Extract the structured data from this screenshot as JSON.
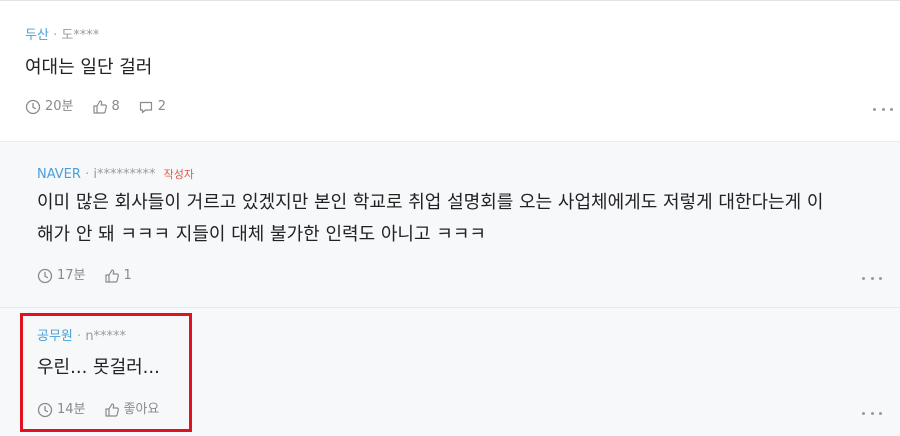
{
  "comments": [
    {
      "company": "두산",
      "separator": "·",
      "user": "도****",
      "author_tag": "",
      "text": "여대는 일단 걸러",
      "time": "20분",
      "likes": "8",
      "replies": "2"
    },
    {
      "company": "NAVER",
      "separator": "·",
      "user": "i*********",
      "author_tag": "작성자",
      "text_line1": "이미 많은 회사들이 거르고 있겠지만 본인 학교로 취업 설명회를 오는 사업체에게도 저렇게 대한다는게 이",
      "text_line2": "해가 안 돼 ㅋㅋㅋ 지들이 대체 불가한 인력도 아니고 ㅋㅋㅋ",
      "time": "17분",
      "likes": "1"
    },
    {
      "company": "공무원",
      "separator": "·",
      "user": "n*****",
      "author_tag": "",
      "text": "우린... 못걸러...",
      "time": "14분",
      "likes": "좋아요"
    }
  ],
  "icons": {
    "time": "clock-icon",
    "like": "thumbs-up-icon",
    "reply": "speech-bubble-icon",
    "more": "more-dots-icon"
  },
  "colors": {
    "company": "#4a9fd8",
    "author_tag": "#e05a4a",
    "highlight_border": "#e0121f",
    "reply_background": "#f7f8f9"
  }
}
